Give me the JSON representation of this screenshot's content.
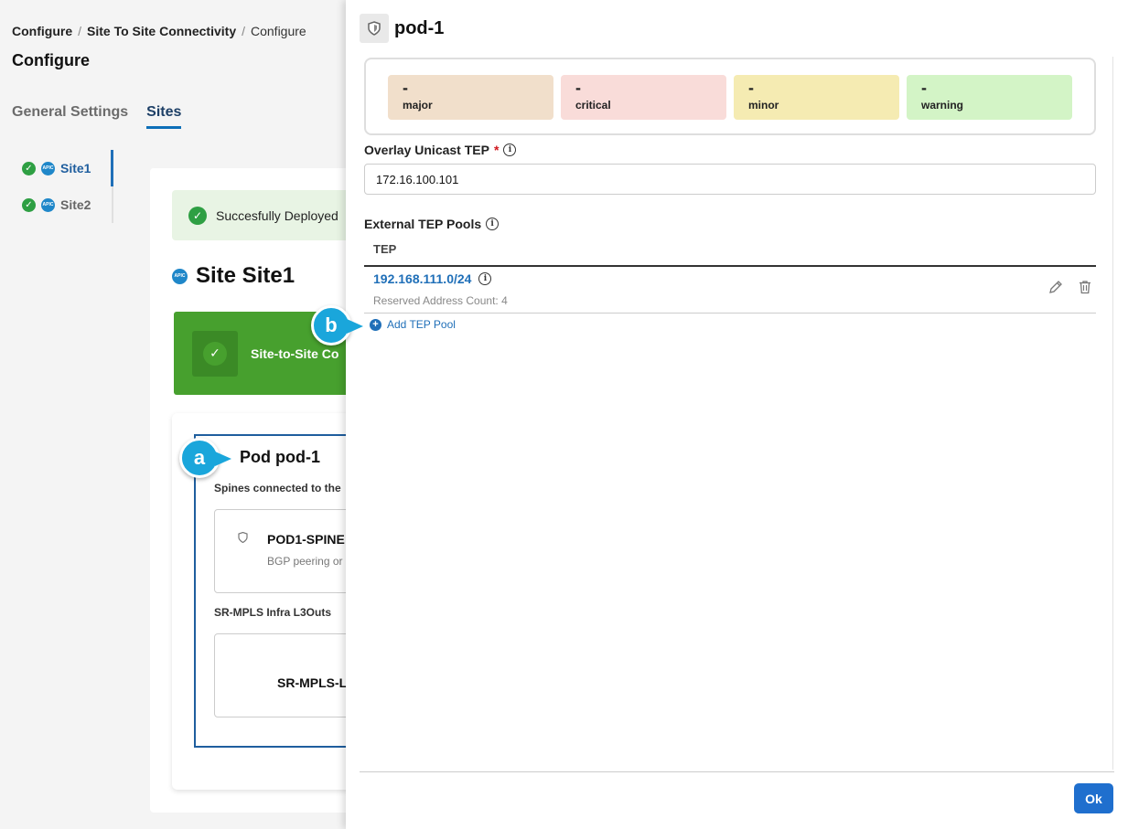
{
  "breadcrumb": {
    "items": [
      "Configure",
      "Site To Site Connectivity"
    ],
    "current": "Configure"
  },
  "page": {
    "title": "Configure"
  },
  "tabs": [
    {
      "label": "General Settings",
      "active": false
    },
    {
      "label": "Sites",
      "active": true
    }
  ],
  "site_nav": [
    {
      "label": "Site1",
      "active": true,
      "status_icon": "check-circle-icon",
      "type_icon": "apic-icon"
    },
    {
      "label": "Site2",
      "active": false,
      "status_icon": "check-circle-icon",
      "type_icon": "apic-icon"
    }
  ],
  "main": {
    "banner_text": "Succesfully Deployed",
    "site_heading": "Site Site1",
    "green_card_label": "Site-to-Site Co",
    "pod_title": "Pod pod-1",
    "spines_label": "Spines connected to the",
    "spine_name": "POD1-SPINE",
    "spine_sub": "BGP peering or",
    "srmpls_label": "SR-MPLS Infra L3Outs",
    "srmpls_name": "SR-MPLS-L"
  },
  "callouts": {
    "a": "a",
    "b": "b"
  },
  "drawer": {
    "title": "pod-1",
    "faults": [
      {
        "value": "-",
        "label": "major",
        "color": "#f1dfcb"
      },
      {
        "value": "-",
        "label": "critical",
        "color": "#f9dcd9"
      },
      {
        "value": "-",
        "label": "minor",
        "color": "#f5ebb2"
      },
      {
        "value": "-",
        "label": "warning",
        "color": "#d3f4c6"
      }
    ],
    "overlay_label": "Overlay Unicast TEP",
    "overlay_required": "*",
    "overlay_value": "172.16.100.101",
    "external_label": "External TEP Pools",
    "table_header": "TEP",
    "tep_rows": [
      {
        "tep": "192.168.111.0/24",
        "sub": "Reserved Address Count: 4"
      }
    ],
    "add_label": "Add TEP Pool",
    "ok_label": "Ok"
  },
  "colors": {
    "accent": "#1f6fce",
    "link": "#1f6fb8",
    "success": "#2e9f43",
    "callout": "#1aa6db"
  }
}
